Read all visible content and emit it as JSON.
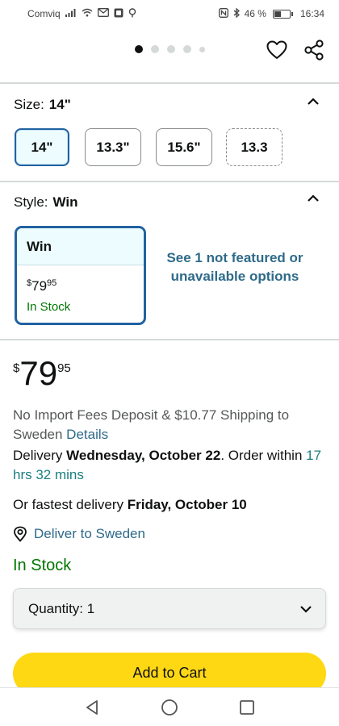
{
  "status_bar": {
    "carrier": "Comviq",
    "battery_percent": "46 %",
    "battery_level": 0.46,
    "time": "16:34"
  },
  "carousel": {
    "dots_total": 5,
    "active_index": 0
  },
  "size": {
    "label": "Size:",
    "selected": "14\"",
    "options": [
      "14\"",
      "13.3\"",
      "15.6\"",
      "13.3"
    ]
  },
  "style": {
    "label": "Style:",
    "selected": "Win",
    "card": {
      "name": "Win",
      "currency": "$",
      "price_whole": "79",
      "price_fraction": "95",
      "availability": "In Stock"
    },
    "see_more": "See 1 not featured or unavailable options"
  },
  "price": {
    "currency": "$",
    "whole": "79",
    "fraction": "95"
  },
  "shipping": {
    "text": "No Import Fees Deposit & $10.77 Shipping to Sweden",
    "details_link": "Details"
  },
  "delivery": {
    "prefix": "Delivery",
    "date": "Wednesday, October 22",
    "mid": ". Order within",
    "countdown": "17 hrs 32 mins"
  },
  "fastest": {
    "prefix": "Or fastest delivery",
    "date": "Friday, October 10"
  },
  "deliver_to": "Deliver to Sweden",
  "availability": "In Stock",
  "quantity": {
    "label": "Quantity:",
    "value": "1"
  },
  "add_to_cart": "Add to Cart",
  "colors": {
    "brand_yellow": "#ffd814",
    "selected_border": "#2162a1",
    "in_stock_green": "#007600",
    "link_teal": "#2e6a8a"
  }
}
